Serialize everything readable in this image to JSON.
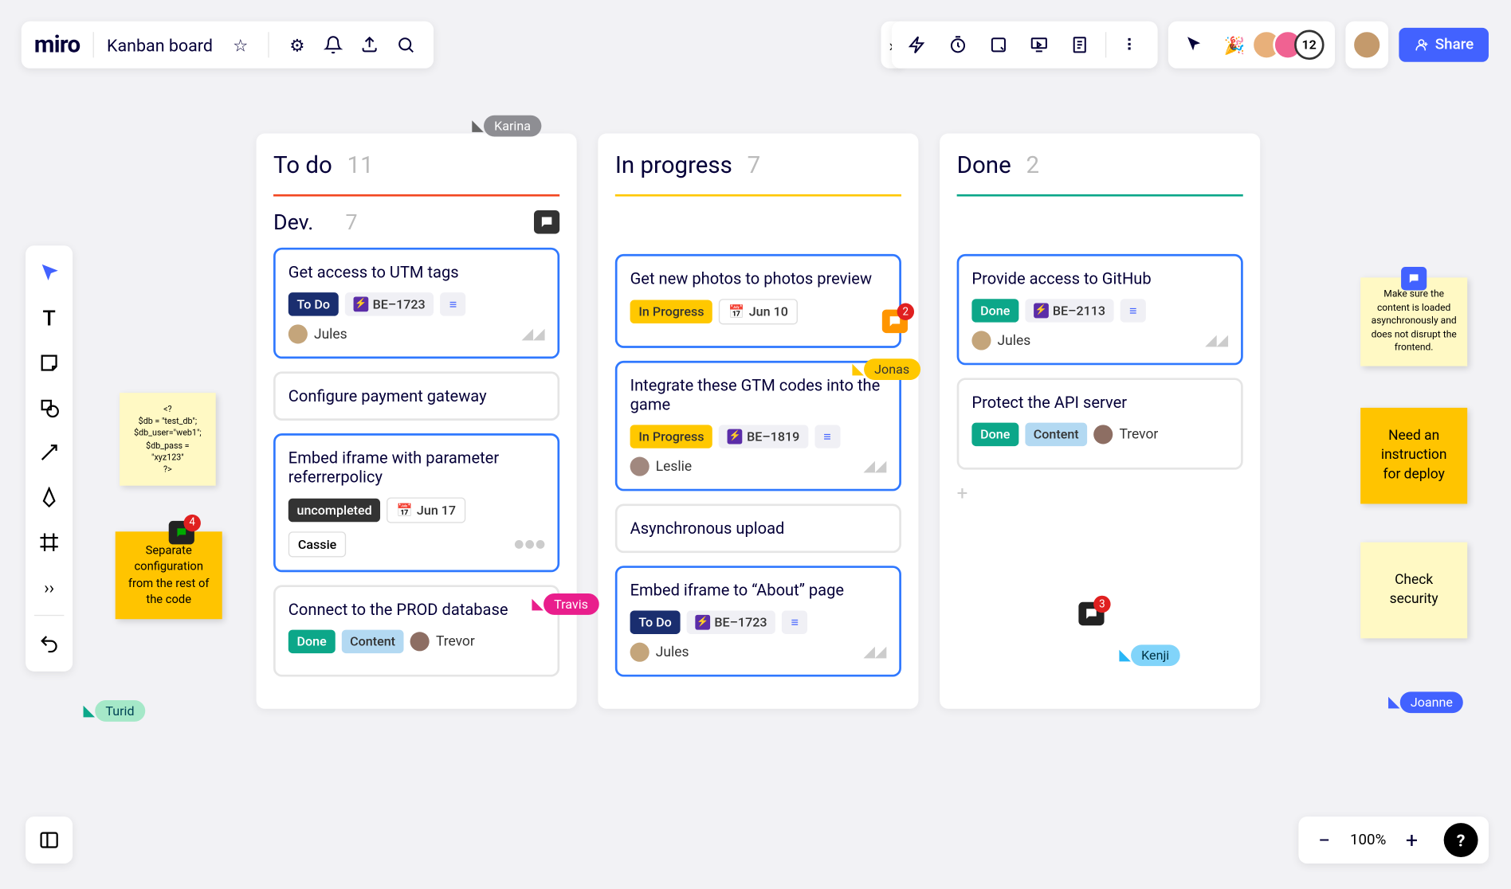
{
  "app": {
    "logo": "miro",
    "board_title": "Kanban board"
  },
  "share": {
    "label": "Share",
    "avatar_count": "12"
  },
  "zoom": {
    "value": "100%",
    "help": "?"
  },
  "cursors": {
    "karina": "Karina",
    "jonas": "Jonas",
    "travis": "Travis",
    "turid": "Turid",
    "kenji": "Kenji",
    "joanne": "Joanne"
  },
  "stickies": {
    "code": "<?\n$db = \"test_db\";\n$db_user=\"web1\";\n$db_pass = \"xyz123\"\n?>",
    "separate": "Separate configuration from the rest of the code",
    "separate_badge": "4",
    "async": "Make sure the content is loaded asynchronously and does not disrupt the frontend.",
    "deploy": "Need an instruction for deploy",
    "security": "Check security"
  },
  "float_comments": {
    "done_badge": "3"
  },
  "columns": {
    "todo": {
      "title": "To do",
      "count": "11",
      "sub": {
        "title": "Dev.",
        "count": "7"
      },
      "cards": [
        {
          "title": "Get access to UTM tags",
          "status": "To Do",
          "status_class": "t-navy",
          "id": "BE–1723",
          "assignee": "Jules"
        },
        {
          "title": "Configure payment gateway"
        },
        {
          "title": "Embed iframe with parameter referrerpolicy",
          "status": "uncompleted",
          "status_class": "t-dark",
          "date": "Jun 17",
          "assignee": "Cassie"
        },
        {
          "title": "Connect to the PROD database",
          "status": "Done",
          "status_class": "t-green",
          "extra": "Content",
          "assignee": "Trevor"
        }
      ]
    },
    "inprogress": {
      "title": "In progress",
      "count": "7",
      "cards": [
        {
          "title": "Get new photos to photos preview",
          "status": "In Progress",
          "status_class": "t-yellow",
          "date": "Jun 10",
          "comment_badge": "2"
        },
        {
          "title": "Integrate these GTM codes into the game",
          "status": "In Progress",
          "status_class": "t-yellow",
          "id": "BE–1819",
          "assignee": "Leslie"
        },
        {
          "title": "Asynchronous upload"
        },
        {
          "title": "Embed iframe to “About” page",
          "status": "To Do",
          "status_class": "t-navy",
          "id": "BE–1723",
          "assignee": "Jules"
        }
      ]
    },
    "done": {
      "title": "Done",
      "count": "2",
      "cards": [
        {
          "title": "Provide access to GitHub",
          "status": "Done",
          "status_class": "t-green",
          "id": "BE–2113",
          "assignee": "Jules"
        },
        {
          "title": "Protect the API server",
          "status": "Done",
          "status_class": "t-green",
          "extra": "Content",
          "assignee": "Trevor"
        }
      ]
    }
  }
}
